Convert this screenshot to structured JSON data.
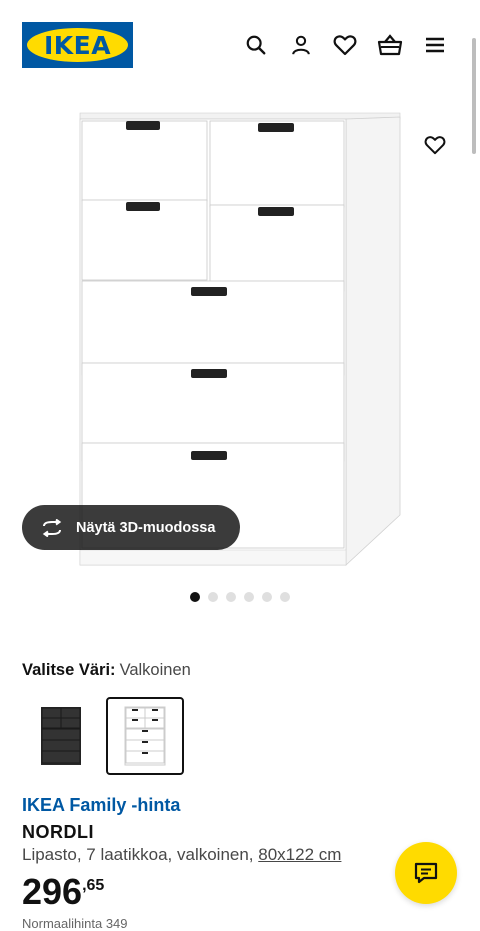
{
  "header": {
    "logo_text": "IKEA",
    "icons": [
      "search-icon",
      "user-icon",
      "heart-icon",
      "basket-icon",
      "menu-icon"
    ]
  },
  "gallery": {
    "view3d_label": "Näytä 3D-muodossa",
    "image_count": 6,
    "active_image": 1
  },
  "color": {
    "label": "Valitse Väri:",
    "value": "Valkoinen",
    "options": [
      "black-brown",
      "white"
    ],
    "selected": "white"
  },
  "product": {
    "family_price_label": "IKEA Family -hinta",
    "name": "NORDLI",
    "description": "Lipasto, 7 laatikkoa, valkoinen, ",
    "size": "80x122 cm",
    "price_int": "296",
    "price_dec": ",65",
    "fine_print": "Normaalihinta 349"
  },
  "colors": {
    "ikea_blue": "#0058a3",
    "ikea_yellow": "#ffdb00",
    "text": "#111111"
  }
}
